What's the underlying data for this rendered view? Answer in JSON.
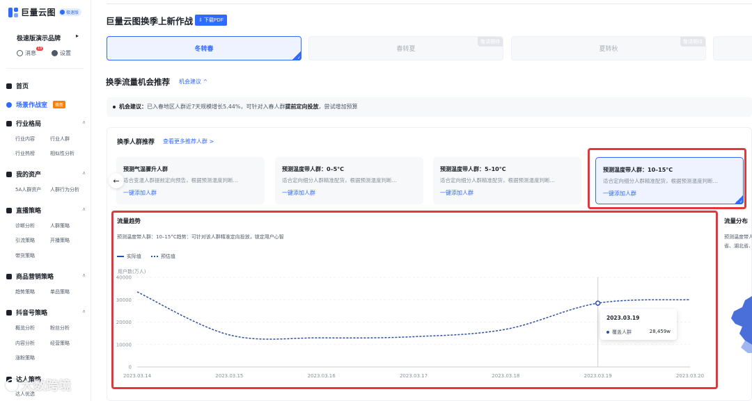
{
  "sidebar": {
    "logo": {
      "text": "巨量云图",
      "badge": "极速版"
    },
    "brand": "极速版演示品牌",
    "utils": {
      "messages": "消息",
      "messages_badge": "19",
      "settings": "设置"
    },
    "nav": {
      "home": "首页",
      "scene": "场景作战室",
      "scene_badge": "焕新",
      "industry": "行业格局",
      "industry_subs": [
        "行业内容",
        "行业人群",
        "行业热榜",
        "相似性分析"
      ],
      "assets": "我的资产",
      "assets_subs": [
        "5A人群资产",
        "人群行为分析"
      ],
      "live": "直播策略",
      "live_subs": [
        "诊断分析",
        "人群策略",
        "引流策略",
        "开播策略",
        "带货策略"
      ],
      "product": "商品营销策略",
      "product_subs": [
        "趋势策略",
        "单品策略"
      ],
      "douyin": "抖音号策略",
      "douyin_subs": [
        "概览分析",
        "粉丝分析",
        "内容分析",
        "经营策略",
        "涨粉策略"
      ],
      "talent": "达人策略",
      "talent_subs": [
        "达人优选"
      ]
    },
    "watermark": "大数跨境"
  },
  "header": {
    "title": "巨量云图换季上新作战",
    "pdf_button": "下载PDF"
  },
  "seasons": [
    {
      "label": "冬转春",
      "active": true,
      "tag": ""
    },
    {
      "label": "春转夏",
      "active": false,
      "tag": "敬请期待"
    },
    {
      "label": "夏转秋",
      "active": false,
      "tag": "敬请期待"
    }
  ],
  "section": {
    "title": "换季流量机会推荐",
    "link": "机会建议 ^",
    "advice_label": "机会建议：",
    "advice_pre": "已入春地区人群近7天规模增长5.44%，可针对入春人群",
    "advice_bold": "提前定向投放",
    "advice_post": "，尝试增加预算"
  },
  "audience": {
    "title": "换季人群推荐",
    "link": "查看更多推荐人群 >",
    "cards": [
      {
        "name": "预测气温骤升人群",
        "desc": "适合变温人群提前定向预告，根据预测温度判断…",
        "add": "一键添加人群"
      },
      {
        "name": "预测温度带人群：0–5°C",
        "desc": "适合定向细分人群精准配货，根据预测温度判断…",
        "add": "一键添加人群"
      },
      {
        "name": "预测温度带人群：5–10°C",
        "desc": "适合定向细分人群精准配货，根据预测温度判断…",
        "add": "一键添加人群"
      },
      {
        "name": "预测温度带人群：10–15°C",
        "desc": "适合定向细分人群精准配货，根据预测温度判断…",
        "add": "一键添加人群"
      }
    ]
  },
  "trend": {
    "title": "流量趋势",
    "subtitle": "预测温度带人群：10–15°C趋势：可针对该人群精准定向投放，锁定用户心智",
    "legend_actual": "实际值",
    "legend_forecast": "预估值"
  },
  "distribution": {
    "title": "流量分布",
    "text1": "预测温度带人",
    "text2": "省、湖北省、"
  },
  "tooltip": {
    "date": "2023.03.19",
    "name": "覆盖人群",
    "value": "28,459w"
  },
  "colors": {
    "accent": "#2f6bff",
    "series": "#2b4ea8",
    "highlight": "#e0383e"
  },
  "chart_data": {
    "type": "line",
    "ylabel": "用户数(万人)",
    "ylim": [
      0,
      40000
    ],
    "yticks": [
      0,
      10000,
      20000,
      30000,
      40000
    ],
    "x": [
      "2023.03.14",
      "2023.03.15",
      "2023.03.16",
      "2023.03.17",
      "2023.03.18",
      "2023.03.19",
      "2023.03.20"
    ],
    "series": [
      {
        "name": "预估值",
        "values": [
          33500,
          14300,
          13000,
          13500,
          16800,
          28459,
          30000
        ]
      }
    ],
    "highlight_index": 5,
    "grid": true
  }
}
